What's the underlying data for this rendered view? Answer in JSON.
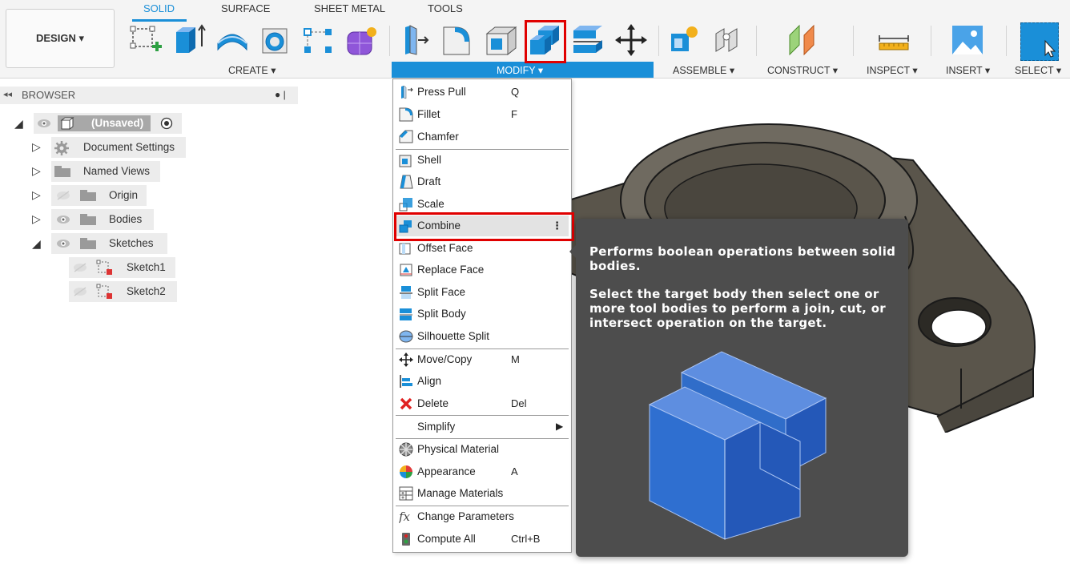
{
  "workspace_button": "DESIGN ▾",
  "tabs": [
    {
      "label": "SOLID",
      "active": true
    },
    {
      "label": "SURFACE",
      "active": false
    },
    {
      "label": "SHEET METAL",
      "active": false
    },
    {
      "label": "TOOLS",
      "active": false
    }
  ],
  "groups": {
    "create": "CREATE ▾",
    "modify": "MODIFY ▾",
    "assemble": "ASSEMBLE ▾",
    "construct": "CONSTRUCT ▾",
    "inspect": "INSPECT ▾",
    "insert": "INSERT ▾",
    "select": "SELECT ▾"
  },
  "browser": {
    "title": "BROWSER",
    "collapse_glyph": "◂◂",
    "pin_glyph": "● |",
    "root": "(Unsaved)",
    "items": [
      {
        "label": "Document Settings",
        "icon": "gear-icon"
      },
      {
        "label": "Named Views",
        "icon": "folder-icon"
      },
      {
        "label": "Origin",
        "icon": "folder-icon"
      },
      {
        "label": "Bodies",
        "icon": "folder-icon"
      },
      {
        "label": "Sketches",
        "icon": "folder-icon"
      },
      {
        "label": "Sketch1",
        "icon": "sketch-icon"
      },
      {
        "label": "Sketch2",
        "icon": "sketch-icon"
      }
    ]
  },
  "modify_menu": {
    "items": [
      {
        "label": "Press Pull",
        "shortcut": "Q",
        "icon": "press-pull-icon"
      },
      {
        "label": "Fillet",
        "shortcut": "F",
        "icon": "fillet-icon"
      },
      {
        "label": "Chamfer",
        "shortcut": "",
        "icon": "chamfer-icon"
      },
      {
        "label": "Shell",
        "shortcut": "",
        "icon": "shell-icon"
      },
      {
        "label": "Draft",
        "shortcut": "",
        "icon": "draft-icon"
      },
      {
        "label": "Scale",
        "shortcut": "",
        "icon": "scale-icon"
      },
      {
        "label": "Combine",
        "shortcut": "⋮",
        "icon": "combine-icon"
      },
      {
        "label": "Offset Face",
        "shortcut": "",
        "icon": "offset-face-icon"
      },
      {
        "label": "Replace Face",
        "shortcut": "",
        "icon": "replace-face-icon"
      },
      {
        "label": "Split Face",
        "shortcut": "",
        "icon": "split-face-icon"
      },
      {
        "label": "Split Body",
        "shortcut": "",
        "icon": "split-body-icon"
      },
      {
        "label": "Silhouette Split",
        "shortcut": "",
        "icon": "silhouette-split-icon"
      },
      {
        "label": "Move/Copy",
        "shortcut": "M",
        "icon": "move-icon"
      },
      {
        "label": "Align",
        "shortcut": "",
        "icon": "align-icon"
      },
      {
        "label": "Delete",
        "shortcut": "Del",
        "icon": "delete-icon"
      },
      {
        "label": "Simplify",
        "shortcut": "▶",
        "icon": ""
      },
      {
        "label": "Physical Material",
        "shortcut": "",
        "icon": "physical-material-icon"
      },
      {
        "label": "Appearance",
        "shortcut": "A",
        "icon": "appearance-icon"
      },
      {
        "label": "Manage Materials",
        "shortcut": "",
        "icon": "manage-materials-icon"
      },
      {
        "label": "Change Parameters",
        "shortcut": "",
        "icon": "fx-icon"
      },
      {
        "label": "Compute All",
        "shortcut": "Ctrl+B",
        "icon": "compute-all-icon"
      }
    ]
  },
  "tooltip": {
    "line1": "Performs boolean operations between solid bodies.",
    "line2": "Select the target body then select one or more tool bodies to perform a join, cut, or intersect operation on the target."
  },
  "colors": {
    "accent": "#1a8fd8",
    "highlight": "#e00000",
    "tooltip_bg": "#4d4d4d",
    "body_blue": "#2f6fd0"
  }
}
